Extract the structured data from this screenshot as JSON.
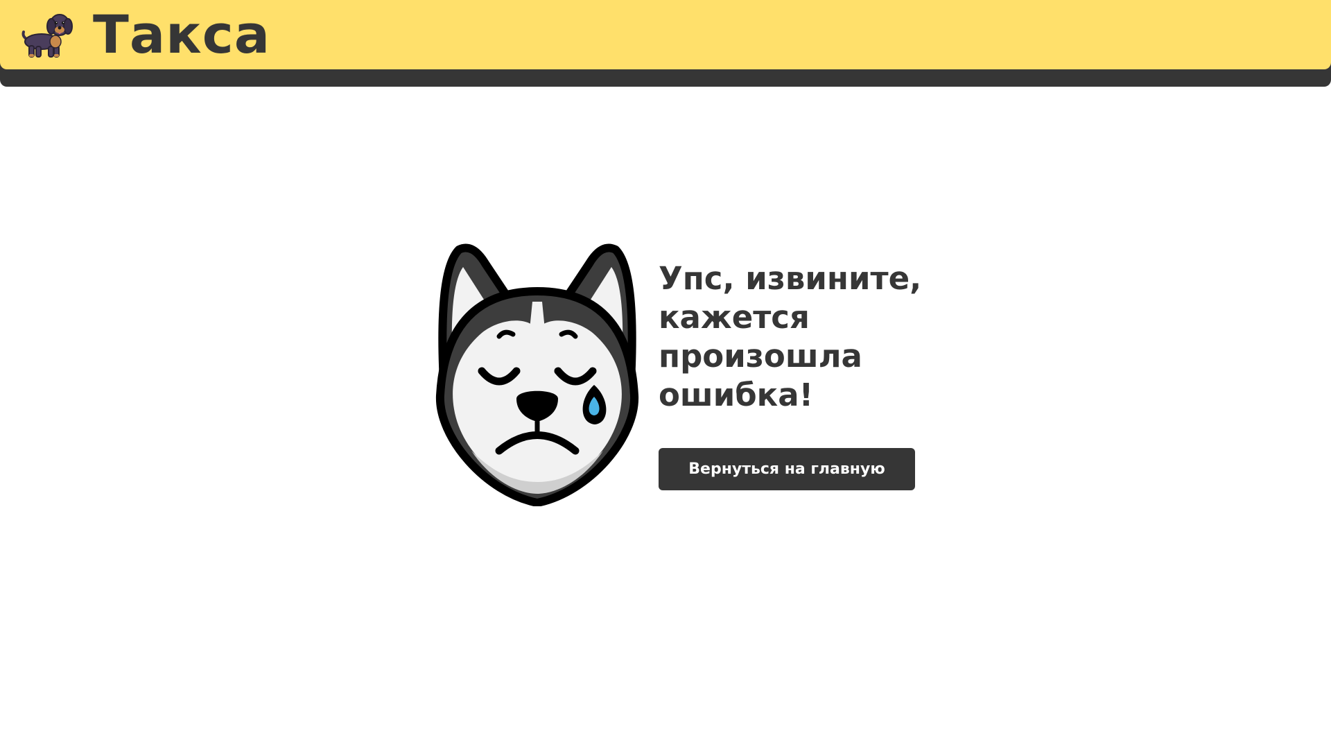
{
  "header": {
    "logo_icon": "dachshund-icon",
    "brand": "Такса",
    "colors": {
      "bar": "#ffe06b",
      "stripe": "#363636"
    }
  },
  "error": {
    "illustration": "sad-husky-icon",
    "message": "Упс, извините, кажется произошла ошибка!",
    "button_label": "Вернуться на главную",
    "colors": {
      "text": "#363636",
      "button_bg": "#363636",
      "button_text": "#ffffff",
      "tear": "#4ab4e6"
    }
  }
}
